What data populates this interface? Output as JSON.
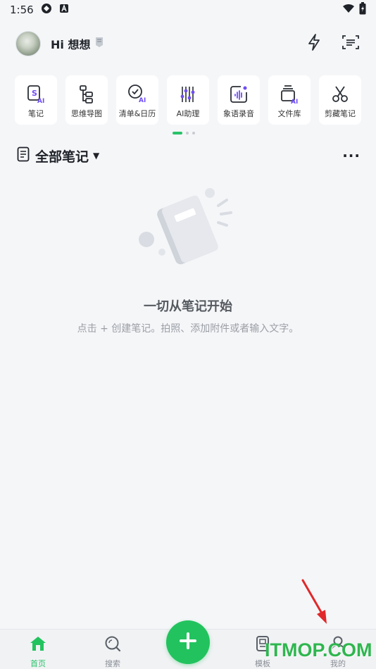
{
  "status_bar": {
    "time": "1:56"
  },
  "header": {
    "greeting": "Hi 想想"
  },
  "tiles": [
    {
      "label": "笔记",
      "icon": "ai-note-icon"
    },
    {
      "label": "思维导图",
      "icon": "mindmap-icon"
    },
    {
      "label": "清单&日历",
      "icon": "ai-checklist-icon"
    },
    {
      "label": "AI助理",
      "icon": "ai-assistant-icon"
    },
    {
      "label": "象语录音",
      "icon": "voice-record-icon"
    },
    {
      "label": "文件库",
      "icon": "ai-file-library-icon"
    },
    {
      "label": "剪藏笔记",
      "icon": "scissors-icon"
    }
  ],
  "section": {
    "title": "全部笔记",
    "more": "···"
  },
  "empty_state": {
    "title": "一切从笔记开始",
    "subtitle": "点击 + 创建笔记。拍照、添加附件或者输入文字。"
  },
  "bottom_nav": {
    "home": "首页",
    "search": "搜索",
    "templates": "模板",
    "mine": "我的"
  },
  "watermark": "ITMOP.COM",
  "colors": {
    "accent": "#22c35e",
    "ai_purple": "#6f4df5",
    "background": "#f5f6f8"
  }
}
